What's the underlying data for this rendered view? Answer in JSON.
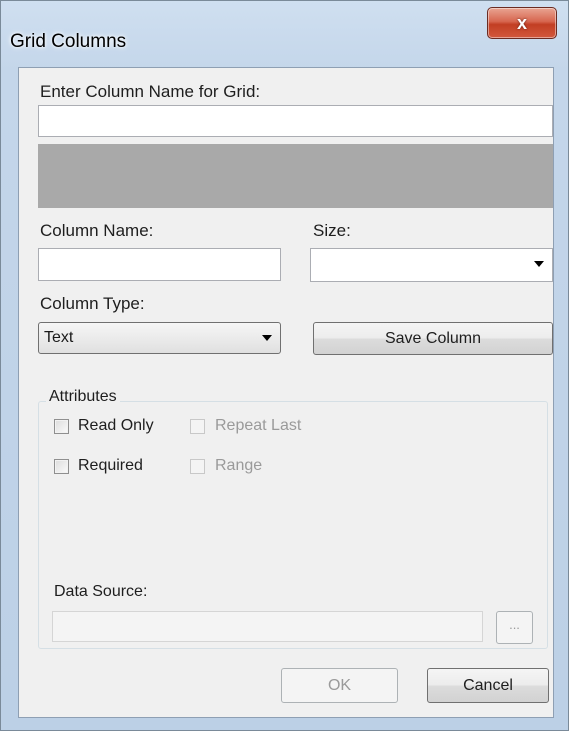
{
  "window": {
    "title": "Grid Columns",
    "close_glyph": "x"
  },
  "form": {
    "grid_column_name_label": "Enter Column Name for Grid:",
    "grid_column_name_value": "",
    "column_name_label": "Column Name:",
    "column_name_value": "",
    "size_label": "Size:",
    "size_value": "",
    "column_type_label": "Column Type:",
    "column_type_value": "Text",
    "save_column_label": "Save Column"
  },
  "attributes": {
    "title": "Attributes",
    "read_only_label": "Read Only",
    "repeat_last_label": "Repeat Last",
    "required_label": "Required",
    "range_label": "Range",
    "data_source_label": "Data Source:",
    "data_source_value": "",
    "browse_label": "..."
  },
  "footer": {
    "ok_label": "OK",
    "cancel_label": "Cancel"
  },
  "colors": {
    "frame": "#c4d6ea",
    "close_button": "#c8452a",
    "client_background": "#f0f0f0",
    "gray_panel": "#a9a9a9",
    "disabled_text": "#9a9a9a"
  }
}
